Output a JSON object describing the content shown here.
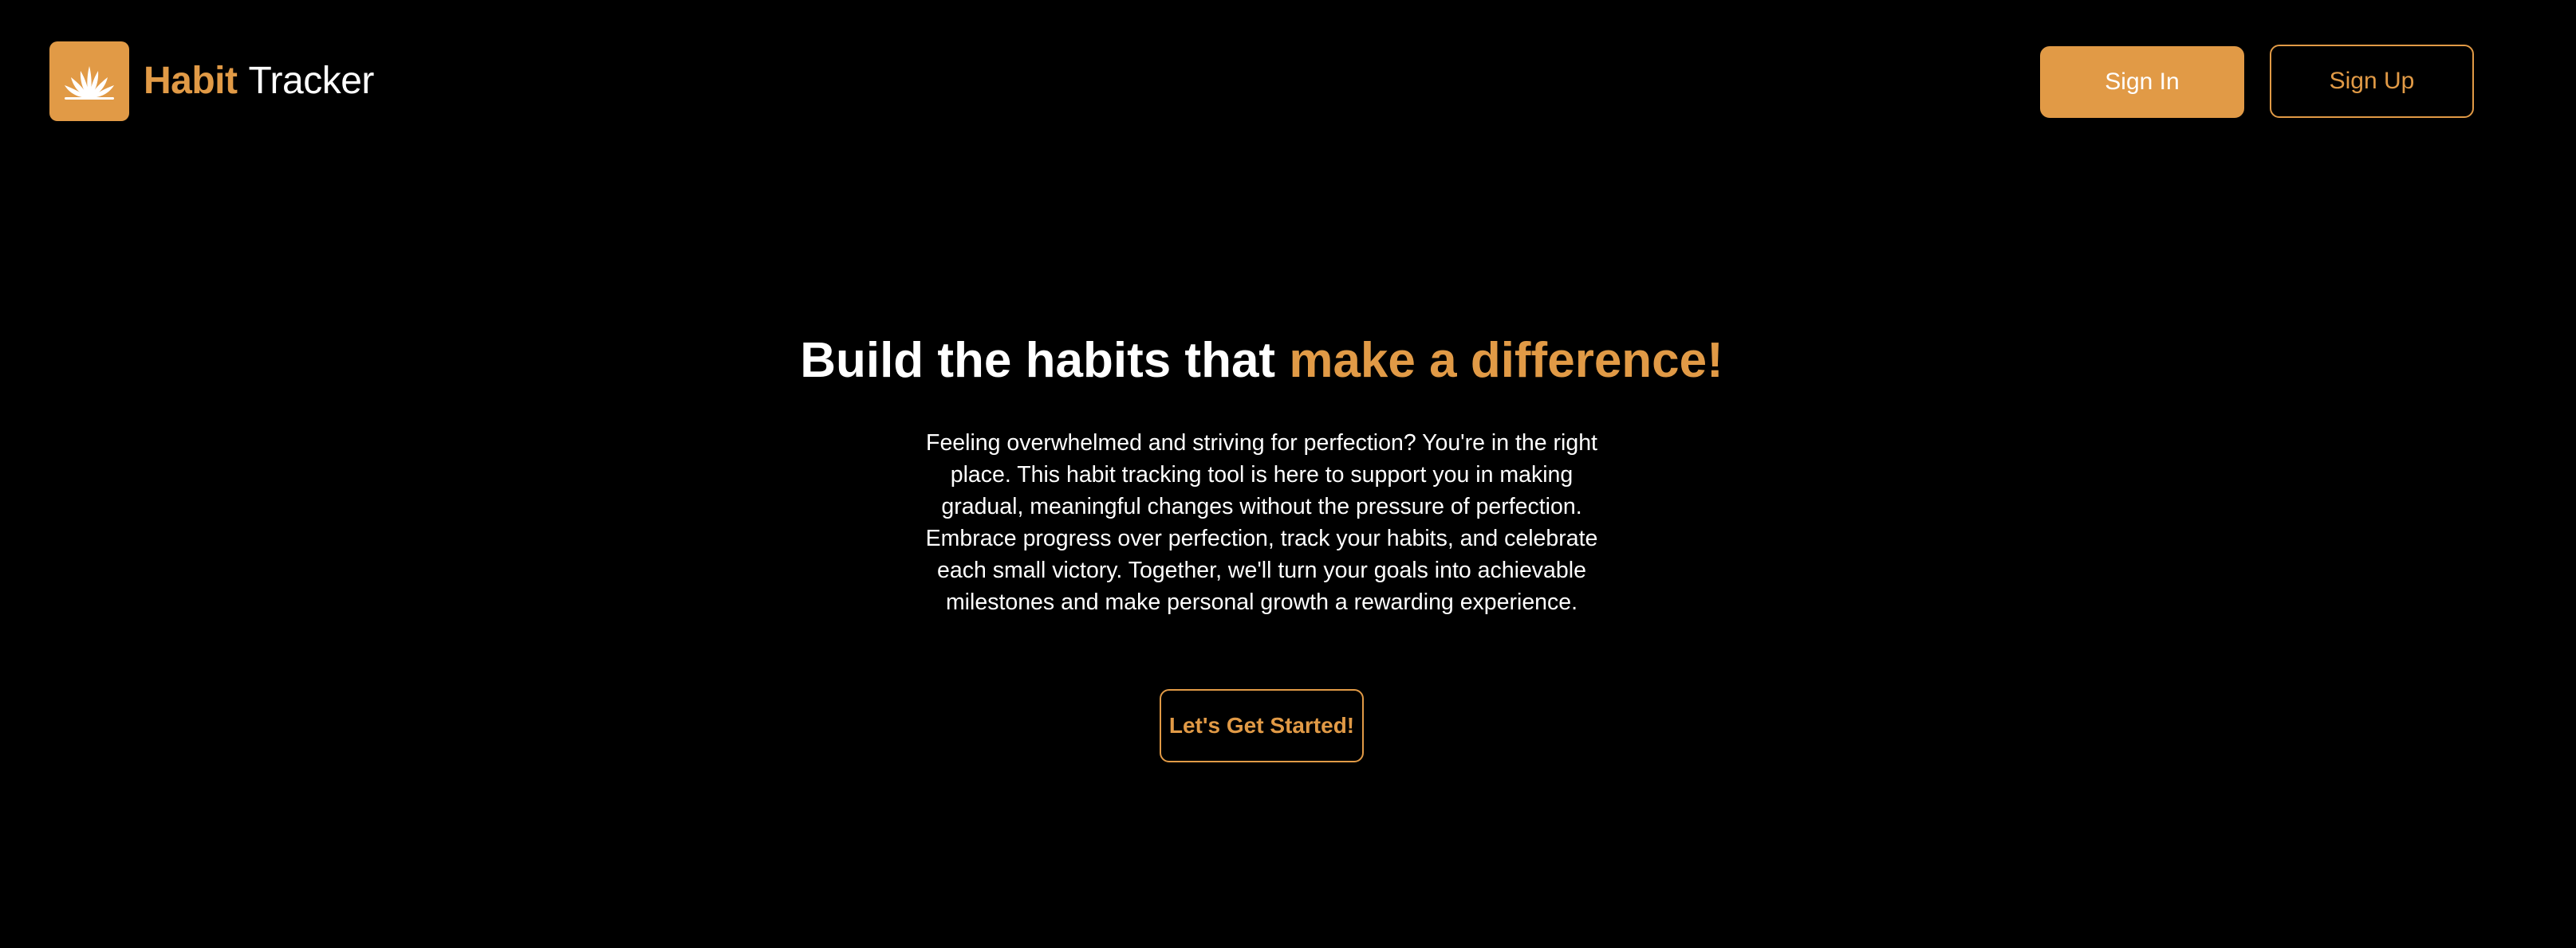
{
  "colors": {
    "background": "#000000",
    "accent": "#e19a46",
    "text": "#ffffff"
  },
  "header": {
    "logo_icon": "lotus-sunrise-icon",
    "brand_primary": "Habit",
    "brand_secondary": "Tracker",
    "sign_in_label": "Sign In",
    "sign_up_label": "Sign Up"
  },
  "hero": {
    "title_main": "Build the habits that ",
    "title_accent": "make a difference!",
    "description": "Feeling overwhelmed and striving for perfection? You're in the right place. This habit tracking tool is here to support you in making gradual, meaningful changes without the pressure of perfection. Embrace progress over perfection, track your habits, and celebrate each small victory. Together, we'll turn your goals into achievable milestones and make personal growth a rewarding experience.",
    "cta_label": "Let's Get Started!"
  }
}
